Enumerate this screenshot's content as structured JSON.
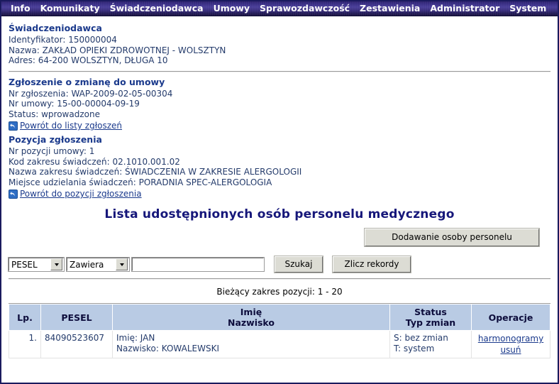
{
  "menu": {
    "items": [
      {
        "label": "Info",
        "name": "menu-item-info"
      },
      {
        "label": "Komunikaty",
        "name": "menu-item-komunikaty"
      },
      {
        "label": "Świadczeniodawca",
        "name": "menu-item-swiadczeniodawca"
      },
      {
        "label": "Umowy",
        "name": "menu-item-umowy"
      },
      {
        "label": "Sprawozdawczość",
        "name": "menu-item-sprawozdawczosc"
      },
      {
        "label": "Zestawienia",
        "name": "menu-item-zestawienia"
      },
      {
        "label": "Administrator",
        "name": "menu-item-administrator"
      },
      {
        "label": "System",
        "name": "menu-item-system"
      }
    ]
  },
  "provider": {
    "heading": "Świadczeniodawca",
    "identifier": "Identyfikator: 150000004",
    "name": "Nazwa: ZAKŁAD OPIEKI ZDROWOTNEJ - WOLSZTYN",
    "address": "Adres: 64-200 WOLSZTYN, DŁUGA 10"
  },
  "application": {
    "heading": "Zgłoszenie o zmianę do umowy",
    "number": "Nr zgłoszenia: WAP-2009-02-05-00304",
    "contract_number": "Nr umowy: 15-00-00004-09-19",
    "status": "Status: wprowadzone",
    "back_link": "Powrót do listy zgłoszeń",
    "back_icon": "back-arrow-icon"
  },
  "position": {
    "heading": "Pozycja zgłoszenia",
    "position_number": "Nr pozycji umowy: 1",
    "scope_code": "Kod zakresu świadczeń: 02.1010.001.02",
    "scope_name": "Nazwa zakresu świadczeń: ŚWIADCZENIA W ZAKRESIE ALERGOLOGII",
    "place": "Miejsce udzielania świadczeń: PORADNIA SPEC-ALERGOLOGIA",
    "back_link": "Powrót do pozycji zgłoszenia",
    "back_icon": "back-arrow-icon"
  },
  "page_title": "Lista udostępnionych osób personelu medycznego",
  "toolbar": {
    "add_person_label": "Dodawanie osoby personelu"
  },
  "search": {
    "field_selected": "PESEL",
    "condition_selected": "Zawiera",
    "query_value": "",
    "query_placeholder": "",
    "search_label": "Szukaj",
    "count_label": "Zlicz rekordy"
  },
  "range_text": "Bieżący zakres pozycji: 1 - 20",
  "table": {
    "headers": {
      "lp": "Lp.",
      "pesel": "PESEL",
      "name_line1": "Imię",
      "name_line2": "Nazwisko",
      "status_line1": "Status",
      "status_line2": "Typ zmian",
      "operations": "Operacje"
    },
    "rows": [
      {
        "lp": "1.",
        "pesel": "84090523607",
        "first_name": "Imię: JAN",
        "last_name": "Nazwisko: KOWALEWSKI",
        "status": "S: bez zmian",
        "change_type": "T: system",
        "op_schedules": "harmonogramy",
        "op_delete": "usuń"
      }
    ]
  },
  "colors": {
    "menubar": "#2e2470",
    "heading": "#1b3a8c",
    "title": "#16177a",
    "table_header_bg": "#b9cbe4",
    "page_border": "#1a1a5e",
    "link": "#1b3a8c"
  }
}
